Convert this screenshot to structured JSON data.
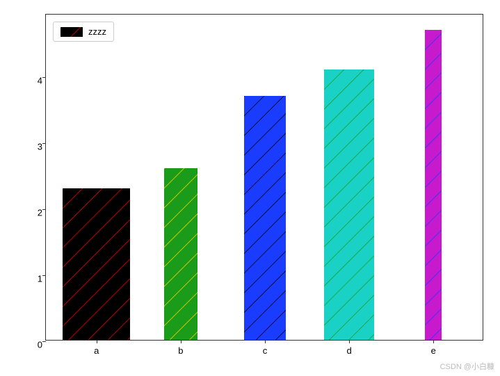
{
  "chart_data": {
    "type": "bar",
    "categories": [
      "a",
      "b",
      "c",
      "d",
      "e"
    ],
    "values": [
      2.3,
      2.6,
      3.7,
      4.1,
      4.7
    ],
    "bar_colors": [
      "#000000",
      "#1a9b1a",
      "#1a3cff",
      "#1ad1c6",
      "#c61acc"
    ],
    "hatch_colors": [
      "#ff0000",
      "#ffd700",
      "#000000",
      "#1a9b1a",
      "#1a3cff"
    ],
    "bar_widths": [
      0.8,
      0.4,
      0.5,
      0.6,
      0.2
    ],
    "ylim": [
      0,
      4.95
    ],
    "yticks": [
      0,
      1,
      2,
      3,
      4
    ],
    "title": "",
    "xlabel": "",
    "ylabel": ""
  },
  "legend": {
    "label": "zzzz"
  },
  "watermark": "CSDN @小白糠"
}
